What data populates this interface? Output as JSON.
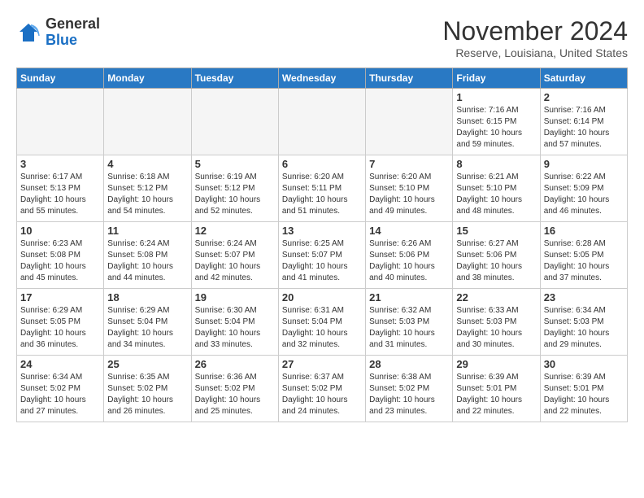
{
  "logo": {
    "general": "General",
    "blue": "Blue"
  },
  "header": {
    "month": "November 2024",
    "location": "Reserve, Louisiana, United States"
  },
  "weekdays": [
    "Sunday",
    "Monday",
    "Tuesday",
    "Wednesday",
    "Thursday",
    "Friday",
    "Saturday"
  ],
  "weeks": [
    [
      {
        "day": "",
        "info": ""
      },
      {
        "day": "",
        "info": ""
      },
      {
        "day": "",
        "info": ""
      },
      {
        "day": "",
        "info": ""
      },
      {
        "day": "",
        "info": ""
      },
      {
        "day": "1",
        "info": "Sunrise: 7:16 AM\nSunset: 6:15 PM\nDaylight: 10 hours\nand 59 minutes."
      },
      {
        "day": "2",
        "info": "Sunrise: 7:16 AM\nSunset: 6:14 PM\nDaylight: 10 hours\nand 57 minutes."
      }
    ],
    [
      {
        "day": "3",
        "info": "Sunrise: 6:17 AM\nSunset: 5:13 PM\nDaylight: 10 hours\nand 55 minutes."
      },
      {
        "day": "4",
        "info": "Sunrise: 6:18 AM\nSunset: 5:12 PM\nDaylight: 10 hours\nand 54 minutes."
      },
      {
        "day": "5",
        "info": "Sunrise: 6:19 AM\nSunset: 5:12 PM\nDaylight: 10 hours\nand 52 minutes."
      },
      {
        "day": "6",
        "info": "Sunrise: 6:20 AM\nSunset: 5:11 PM\nDaylight: 10 hours\nand 51 minutes."
      },
      {
        "day": "7",
        "info": "Sunrise: 6:20 AM\nSunset: 5:10 PM\nDaylight: 10 hours\nand 49 minutes."
      },
      {
        "day": "8",
        "info": "Sunrise: 6:21 AM\nSunset: 5:10 PM\nDaylight: 10 hours\nand 48 minutes."
      },
      {
        "day": "9",
        "info": "Sunrise: 6:22 AM\nSunset: 5:09 PM\nDaylight: 10 hours\nand 46 minutes."
      }
    ],
    [
      {
        "day": "10",
        "info": "Sunrise: 6:23 AM\nSunset: 5:08 PM\nDaylight: 10 hours\nand 45 minutes."
      },
      {
        "day": "11",
        "info": "Sunrise: 6:24 AM\nSunset: 5:08 PM\nDaylight: 10 hours\nand 44 minutes."
      },
      {
        "day": "12",
        "info": "Sunrise: 6:24 AM\nSunset: 5:07 PM\nDaylight: 10 hours\nand 42 minutes."
      },
      {
        "day": "13",
        "info": "Sunrise: 6:25 AM\nSunset: 5:07 PM\nDaylight: 10 hours\nand 41 minutes."
      },
      {
        "day": "14",
        "info": "Sunrise: 6:26 AM\nSunset: 5:06 PM\nDaylight: 10 hours\nand 40 minutes."
      },
      {
        "day": "15",
        "info": "Sunrise: 6:27 AM\nSunset: 5:06 PM\nDaylight: 10 hours\nand 38 minutes."
      },
      {
        "day": "16",
        "info": "Sunrise: 6:28 AM\nSunset: 5:05 PM\nDaylight: 10 hours\nand 37 minutes."
      }
    ],
    [
      {
        "day": "17",
        "info": "Sunrise: 6:29 AM\nSunset: 5:05 PM\nDaylight: 10 hours\nand 36 minutes."
      },
      {
        "day": "18",
        "info": "Sunrise: 6:29 AM\nSunset: 5:04 PM\nDaylight: 10 hours\nand 34 minutes."
      },
      {
        "day": "19",
        "info": "Sunrise: 6:30 AM\nSunset: 5:04 PM\nDaylight: 10 hours\nand 33 minutes."
      },
      {
        "day": "20",
        "info": "Sunrise: 6:31 AM\nSunset: 5:04 PM\nDaylight: 10 hours\nand 32 minutes."
      },
      {
        "day": "21",
        "info": "Sunrise: 6:32 AM\nSunset: 5:03 PM\nDaylight: 10 hours\nand 31 minutes."
      },
      {
        "day": "22",
        "info": "Sunrise: 6:33 AM\nSunset: 5:03 PM\nDaylight: 10 hours\nand 30 minutes."
      },
      {
        "day": "23",
        "info": "Sunrise: 6:34 AM\nSunset: 5:03 PM\nDaylight: 10 hours\nand 29 minutes."
      }
    ],
    [
      {
        "day": "24",
        "info": "Sunrise: 6:34 AM\nSunset: 5:02 PM\nDaylight: 10 hours\nand 27 minutes."
      },
      {
        "day": "25",
        "info": "Sunrise: 6:35 AM\nSunset: 5:02 PM\nDaylight: 10 hours\nand 26 minutes."
      },
      {
        "day": "26",
        "info": "Sunrise: 6:36 AM\nSunset: 5:02 PM\nDaylight: 10 hours\nand 25 minutes."
      },
      {
        "day": "27",
        "info": "Sunrise: 6:37 AM\nSunset: 5:02 PM\nDaylight: 10 hours\nand 24 minutes."
      },
      {
        "day": "28",
        "info": "Sunrise: 6:38 AM\nSunset: 5:02 PM\nDaylight: 10 hours\nand 23 minutes."
      },
      {
        "day": "29",
        "info": "Sunrise: 6:39 AM\nSunset: 5:01 PM\nDaylight: 10 hours\nand 22 minutes."
      },
      {
        "day": "30",
        "info": "Sunrise: 6:39 AM\nSunset: 5:01 PM\nDaylight: 10 hours\nand 22 minutes."
      }
    ]
  ]
}
